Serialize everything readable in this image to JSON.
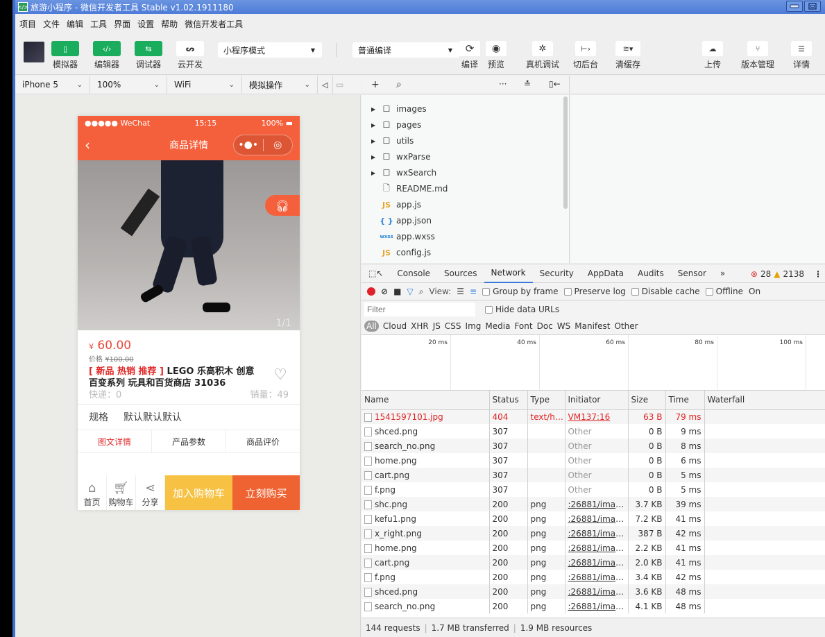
{
  "window": {
    "title": "旅游小程序 - 微信开发者工具 Stable v1.02.1911180",
    "app_icon": "</>"
  },
  "menu": [
    "项目",
    "文件",
    "编辑",
    "工具",
    "界面",
    "设置",
    "帮助",
    "微信开发者工具"
  ],
  "toolbar": {
    "simulator": "模拟器",
    "editor": "编辑器",
    "debugger": "调试器",
    "cloud": "云开发",
    "mode_select": "小程序模式",
    "compile_select": "普通编译",
    "compile": "编译",
    "preview": "预览",
    "remote_debug": "真机调试",
    "background": "切后台",
    "clear_cache": "清缓存",
    "upload": "上传",
    "version": "版本管理",
    "details": "详情"
  },
  "sim_bar": {
    "device": "iPhone 5",
    "zoom": "100%",
    "network": "WiFi",
    "operation": "模拟操作"
  },
  "phone": {
    "status_left": "●●●●● WeChat",
    "status_time": "15:15",
    "status_battery": "100%",
    "nav_title": "商品详情",
    "image_counter": "1/1",
    "price_symbol": "¥",
    "price": "60.00",
    "orig_label": "价格",
    "orig_price": "¥100.00",
    "tag": "[ 新品 热销 推荐 ]",
    "title": "LEGO 乐高积木 创意百变系列 玩具和百货商店 31036",
    "shipping": "快递：0",
    "sales": "销量：49",
    "spec_label": "规格",
    "spec_value": "默认默认默认",
    "tabs": [
      "图文详情",
      "产品参数",
      "商品评价"
    ],
    "bottom": {
      "home": "首页",
      "cart": "购物车",
      "share": "分享",
      "add_cart": "加入购物车",
      "buy": "立刻购买"
    }
  },
  "file_tree": [
    {
      "name": "images",
      "type": "folder"
    },
    {
      "name": "pages",
      "type": "folder"
    },
    {
      "name": "utils",
      "type": "folder"
    },
    {
      "name": "wxParse",
      "type": "folder"
    },
    {
      "name": "wxSearch",
      "type": "folder"
    },
    {
      "name": "README.md",
      "type": "md"
    },
    {
      "name": "app.js",
      "type": "js"
    },
    {
      "name": "app.json",
      "type": "json"
    },
    {
      "name": "app.wxss",
      "type": "wxss"
    },
    {
      "name": "config.js",
      "type": "js"
    }
  ],
  "devtools": {
    "tabs": [
      "Console",
      "Sources",
      "Network",
      "Security",
      "AppData",
      "Audits",
      "Sensor"
    ],
    "active_tab": "Network",
    "more": "»",
    "errors": "28",
    "warnings": "2138",
    "view_label": "View:",
    "group_by_frame": "Group by frame",
    "preserve_log": "Preserve log",
    "disable_cache": "Disable cache",
    "offline": "Offline",
    "online": "On",
    "filter_placeholder": "Filter",
    "hide_data_urls": "Hide data URLs",
    "types": [
      "All",
      "Cloud",
      "XHR",
      "JS",
      "CSS",
      "Img",
      "Media",
      "Font",
      "Doc",
      "WS",
      "Manifest",
      "Other"
    ],
    "overview_ticks": [
      "20 ms",
      "40 ms",
      "60 ms",
      "80 ms",
      "100 ms"
    ],
    "columns": [
      "Name",
      "Status",
      "Type",
      "Initiator",
      "Size",
      "Time",
      "Waterfall"
    ],
    "rows": [
      {
        "name": "1541597101.jpg",
        "status": "404",
        "type": "text/ht...",
        "initiator": "VM137:16",
        "size": "63 B",
        "time": "79 ms",
        "error": true
      },
      {
        "name": "shced.png",
        "status": "307",
        "type": "",
        "initiator": "Other",
        "size": "0 B",
        "time": "9 ms"
      },
      {
        "name": "search_no.png",
        "status": "307",
        "type": "",
        "initiator": "Other",
        "size": "0 B",
        "time": "8 ms"
      },
      {
        "name": "home.png",
        "status": "307",
        "type": "",
        "initiator": "Other",
        "size": "0 B",
        "time": "6 ms"
      },
      {
        "name": "cart.png",
        "status": "307",
        "type": "",
        "initiator": "Other",
        "size": "0 B",
        "time": "5 ms"
      },
      {
        "name": "f.png",
        "status": "307",
        "type": "",
        "initiator": "Other",
        "size": "0 B",
        "time": "5 ms"
      },
      {
        "name": "shc.png",
        "status": "200",
        "type": "png",
        "initiator": ":26881/image...",
        "size": "3.7 KB",
        "time": "39 ms"
      },
      {
        "name": "kefu1.png",
        "status": "200",
        "type": "png",
        "initiator": ":26881/image...",
        "size": "7.2 KB",
        "time": "41 ms"
      },
      {
        "name": "x_right.png",
        "status": "200",
        "type": "png",
        "initiator": ":26881/image...",
        "size": "387 B",
        "time": "42 ms"
      },
      {
        "name": "home.png",
        "status": "200",
        "type": "png",
        "initiator": ":26881/image...",
        "size": "2.2 KB",
        "time": "41 ms"
      },
      {
        "name": "cart.png",
        "status": "200",
        "type": "png",
        "initiator": ":26881/image...",
        "size": "2.0 KB",
        "time": "41 ms"
      },
      {
        "name": "f.png",
        "status": "200",
        "type": "png",
        "initiator": ":26881/image...",
        "size": "3.4 KB",
        "time": "42 ms"
      },
      {
        "name": "shced.png",
        "status": "200",
        "type": "png",
        "initiator": ":26881/image...",
        "size": "3.6 KB",
        "time": "48 ms"
      },
      {
        "name": "search_no.png",
        "status": "200",
        "type": "png",
        "initiator": ":26881/image...",
        "size": "4.1 KB",
        "time": "48 ms"
      }
    ],
    "summary": {
      "requests": "144 requests",
      "transferred": "1.7 MB transferred",
      "resources": "1.9 MB resources"
    }
  }
}
